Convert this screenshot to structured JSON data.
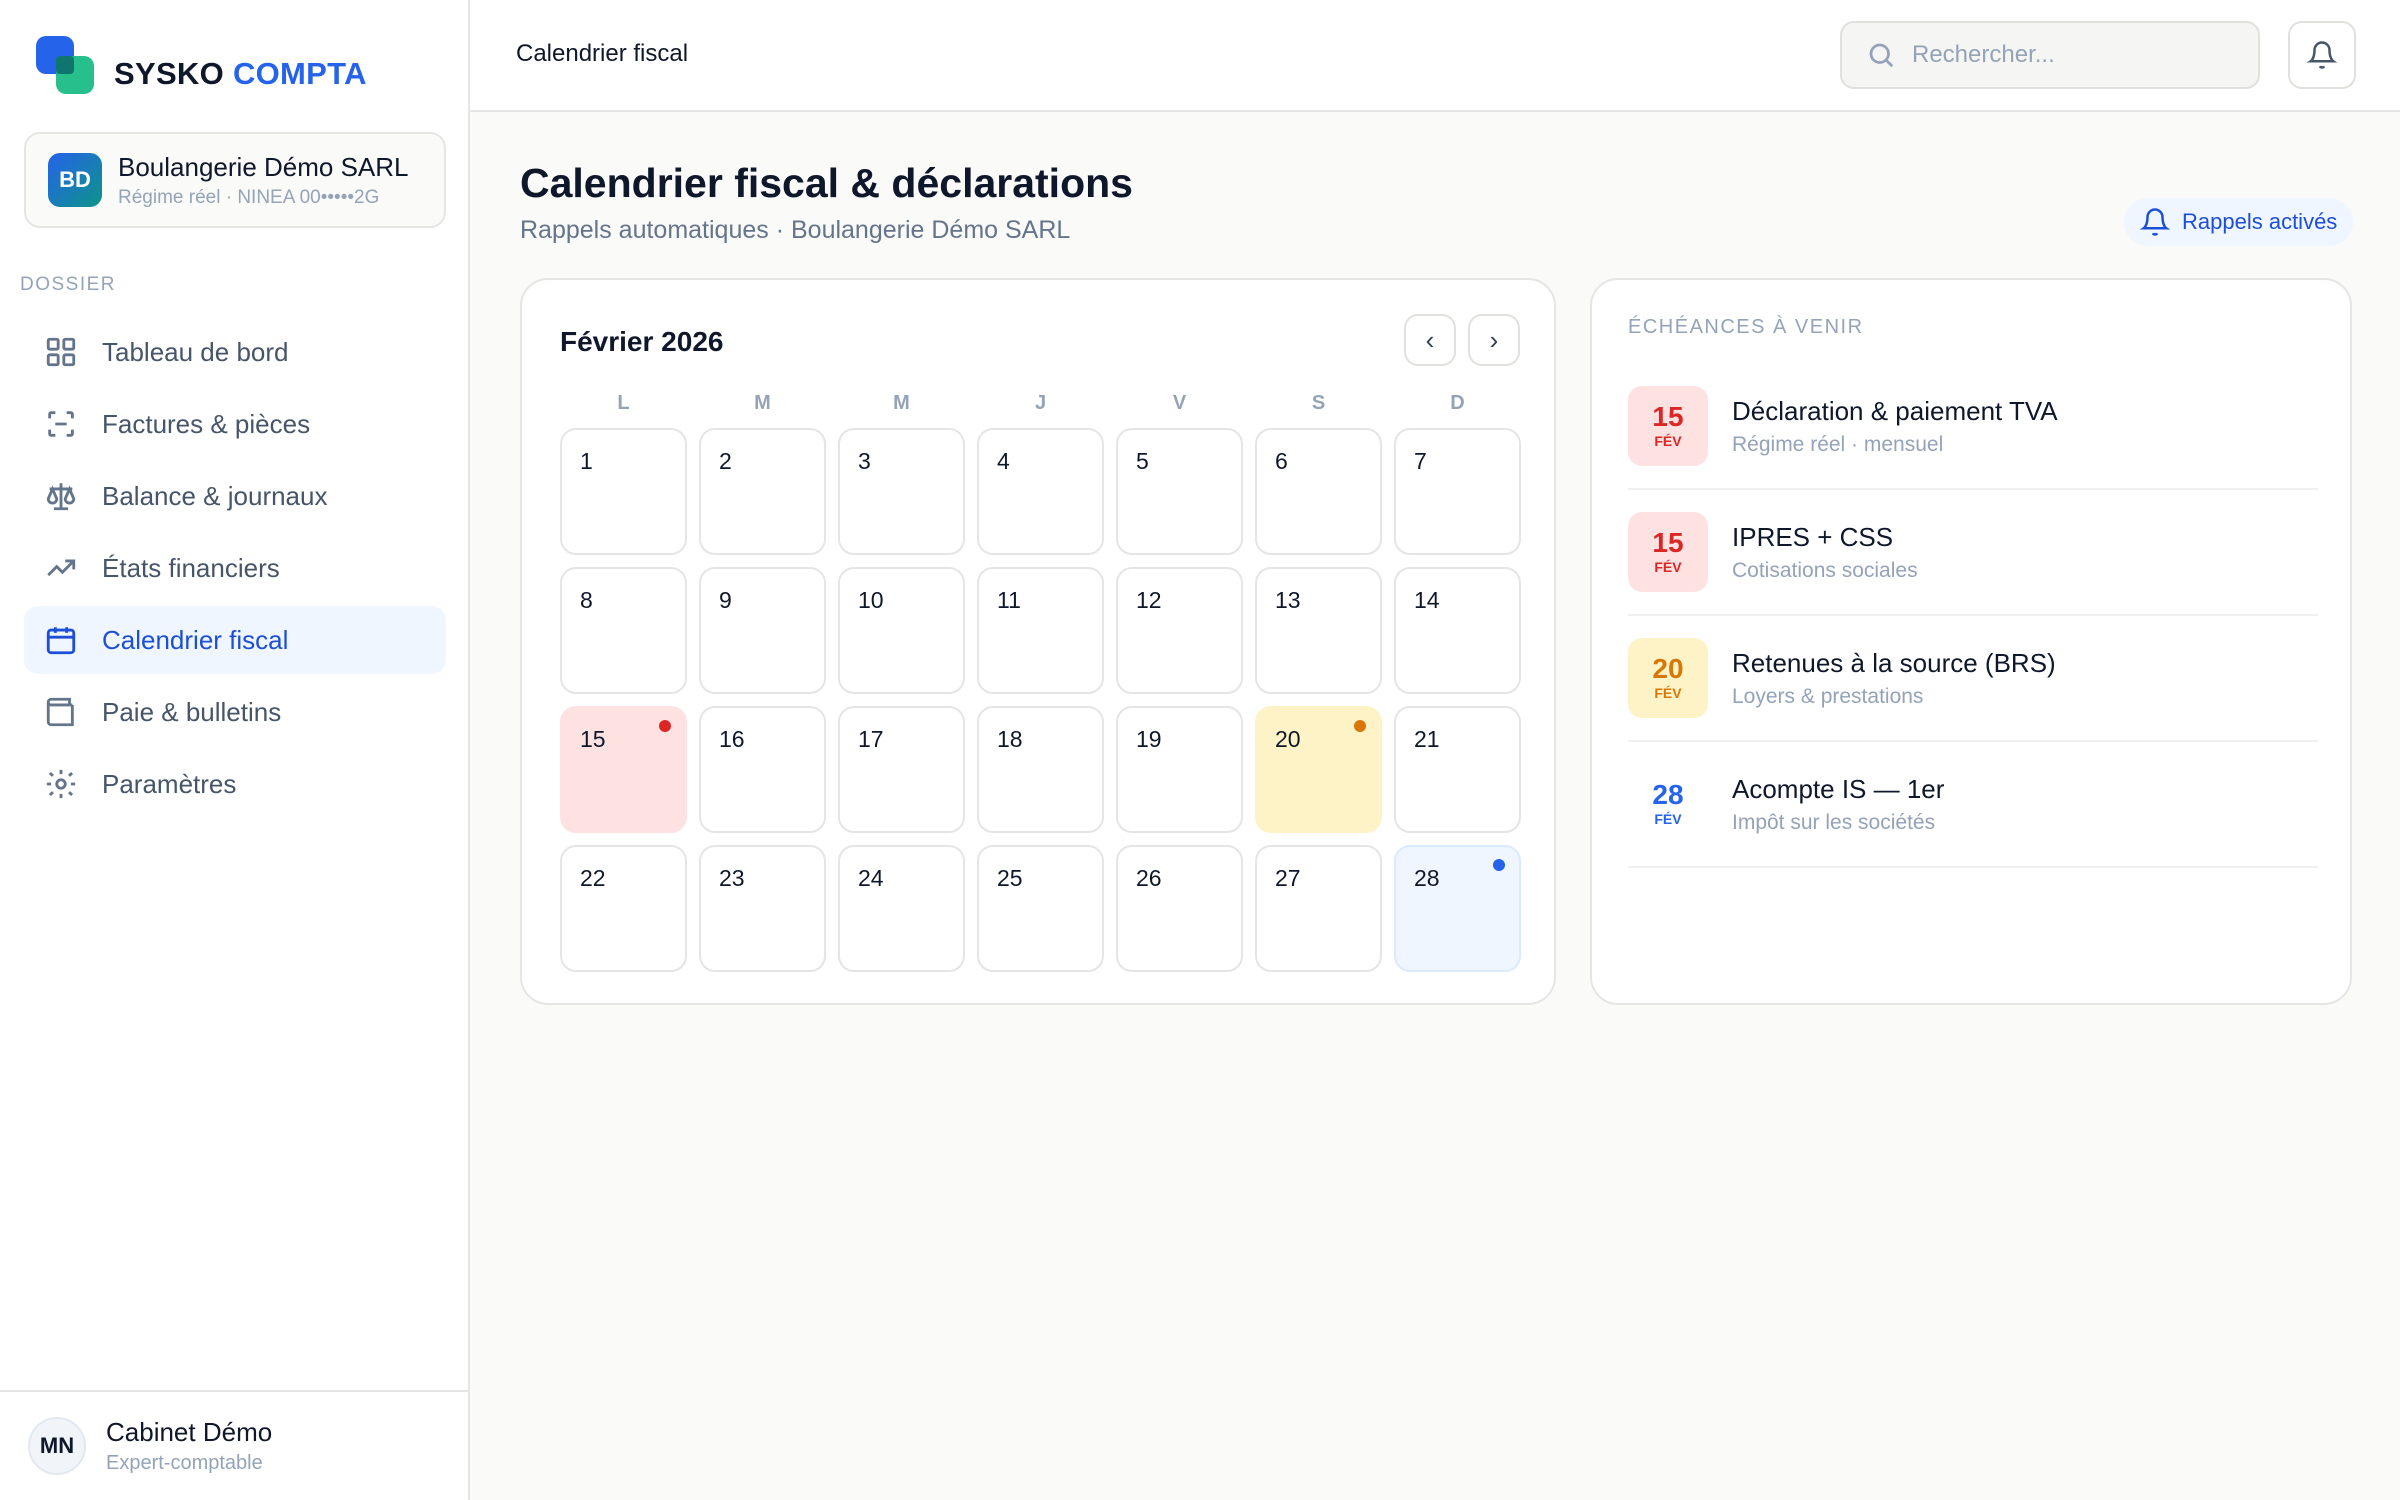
{
  "brand": {
    "name_part1": "SYSKO",
    "name_part2": "COMPTA"
  },
  "company": {
    "initials": "BD",
    "name": "Boulangerie Démo SARL",
    "subtitle": "Régime réel · NINEA 00•••••2G"
  },
  "sidebar": {
    "section_label": "DOSSIER",
    "items": [
      {
        "label": "Tableau de bord",
        "icon": "grid-icon",
        "active": false
      },
      {
        "label": "Factures & pièces",
        "icon": "scan-icon",
        "active": false
      },
      {
        "label": "Balance & journaux",
        "icon": "scale-icon",
        "active": false
      },
      {
        "label": "États financiers",
        "icon": "trending-up-icon",
        "active": false
      },
      {
        "label": "Calendrier fiscal",
        "icon": "calendar-icon",
        "active": true
      },
      {
        "label": "Paie & bulletins",
        "icon": "wallet-icon",
        "active": false
      },
      {
        "label": "Paramètres",
        "icon": "settings-icon",
        "active": false
      }
    ]
  },
  "user": {
    "initials": "MN",
    "name": "Cabinet Démo",
    "role": "Expert-comptable"
  },
  "topbar": {
    "title": "Calendrier fiscal",
    "search_placeholder": "Rechercher..."
  },
  "page": {
    "title": "Calendrier fiscal & déclarations",
    "subtitle": "Rappels automatiques · Boulangerie Démo SARL",
    "reminders_label": "Rappels activés"
  },
  "calendar": {
    "month": "Février 2026",
    "prev_label": "‹",
    "next_label": "›",
    "weekdays": [
      "L",
      "M",
      "M",
      "J",
      "V",
      "S",
      "D"
    ],
    "days": [
      {
        "n": "1"
      },
      {
        "n": "2"
      },
      {
        "n": "3"
      },
      {
        "n": "4"
      },
      {
        "n": "5"
      },
      {
        "n": "6"
      },
      {
        "n": "7"
      },
      {
        "n": "8"
      },
      {
        "n": "9"
      },
      {
        "n": "10"
      },
      {
        "n": "11"
      },
      {
        "n": "12"
      },
      {
        "n": "13"
      },
      {
        "n": "14"
      },
      {
        "n": "15",
        "status": "red"
      },
      {
        "n": "16"
      },
      {
        "n": "17"
      },
      {
        "n": "18"
      },
      {
        "n": "19"
      },
      {
        "n": "20",
        "status": "amber"
      },
      {
        "n": "21"
      },
      {
        "n": "22"
      },
      {
        "n": "23"
      },
      {
        "n": "24"
      },
      {
        "n": "25"
      },
      {
        "n": "26"
      },
      {
        "n": "27"
      },
      {
        "n": "28",
        "status": "blue"
      }
    ]
  },
  "colors": {
    "red": "#dc2626",
    "amber": "#d97706",
    "blue": "#2563eb"
  },
  "deadlines": {
    "heading": "ÉCHÉANCES À VENIR",
    "items": [
      {
        "day": "15",
        "month": "FÉV",
        "title": "Déclaration & paiement TVA",
        "subtitle": "Régime réel · mensuel",
        "status": "red"
      },
      {
        "day": "15",
        "month": "FÉV",
        "title": "IPRES + CSS",
        "subtitle": "Cotisations sociales",
        "status": "red"
      },
      {
        "day": "20",
        "month": "FÉV",
        "title": "Retenues à la source (BRS)",
        "subtitle": "Loyers & prestations",
        "status": "amber"
      },
      {
        "day": "28",
        "month": "FÉV",
        "title": "Acompte IS — 1er",
        "subtitle": "Impôt sur les sociétés",
        "status": "blue"
      }
    ]
  }
}
